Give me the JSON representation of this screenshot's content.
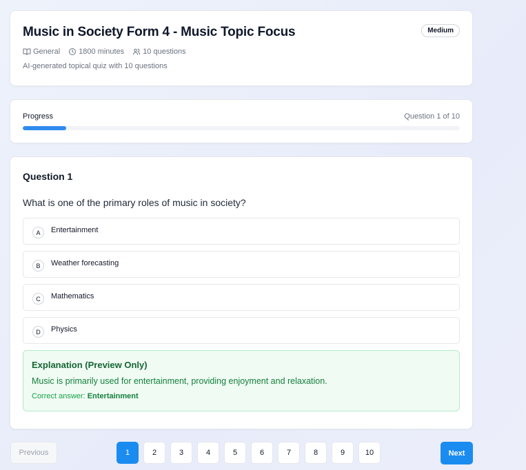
{
  "colors": {
    "accent": "#1a8cf0",
    "progress": "#2f8bef",
    "success_bg": "#effbf3",
    "success_text": "#15803d"
  },
  "quiz": {
    "title": "Music in Society Form 4 - Music Topic Focus",
    "difficulty": "Medium",
    "meta": {
      "subject": "General",
      "subject_icon": "book-icon",
      "duration": "1800 minutes",
      "duration_icon": "clock-icon",
      "questions": "10 questions",
      "questions_icon": "users-icon"
    },
    "description": "AI-generated topical quiz with 10 questions"
  },
  "progress": {
    "label": "Progress",
    "counter": "Question 1 of 10",
    "fraction": 0.1
  },
  "question": {
    "number_label": "Question 1",
    "text": "What is one of the primary roles of music in society?",
    "options": [
      {
        "letter": "A",
        "text": "Entertainment"
      },
      {
        "letter": "B",
        "text": "Weather forecasting"
      },
      {
        "letter": "C",
        "text": "Mathematics"
      },
      {
        "letter": "D",
        "text": "Physics"
      }
    ],
    "explanation": {
      "title": "Explanation (Preview Only)",
      "text": "Music is primarily used for entertainment, providing enjoyment and relaxation.",
      "correct_label": "Correct answer: ",
      "correct_value": "Entertainment"
    }
  },
  "nav": {
    "previous_label": "Previous",
    "next_label": "Next",
    "pages": [
      "1",
      "2",
      "3",
      "4",
      "5",
      "6",
      "7",
      "8",
      "9",
      "10"
    ],
    "current_page": "1"
  }
}
